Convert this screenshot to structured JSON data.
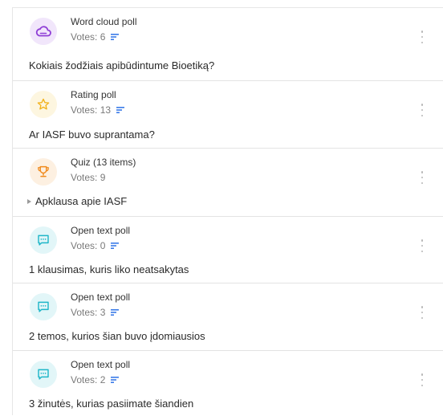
{
  "polls": [
    {
      "kind": "word-cloud",
      "type_label": "Word cloud poll",
      "votes_label": "Votes: 6",
      "results_icon": true,
      "question": "Kokiais žodžiais apibūdintume Bioetiką?",
      "icon": "word-cloud-icon",
      "icon_color": "#8f3fd6",
      "icon_bg": "#f1e6fb"
    },
    {
      "kind": "rating",
      "type_label": "Rating poll",
      "votes_label": "Votes: 13",
      "results_icon": true,
      "question": "Ar IASF buvo suprantama?",
      "icon": "star-icon",
      "icon_color": "#f2b21b",
      "icon_bg": "#fdf6e0"
    },
    {
      "kind": "quiz",
      "type_label": "Quiz (13 items)",
      "votes_label": "Votes: 9",
      "results_icon": false,
      "question": "Apklausa apie IASF",
      "icon": "trophy-icon",
      "icon_color": "#f08a1c",
      "icon_bg": "#fdf0e1"
    },
    {
      "kind": "open-text",
      "type_label": "Open text poll",
      "votes_label": "Votes: 0",
      "results_icon": true,
      "question": "1 klausimas, kuris liko neatsakytas",
      "icon": "chat-icon",
      "icon_color": "#1fb6c8",
      "icon_bg": "#e2f6f8"
    },
    {
      "kind": "open-text",
      "type_label": "Open text poll",
      "votes_label": "Votes: 3",
      "results_icon": true,
      "question": "2 temos, kurios šian buvo įdomiausios",
      "icon": "chat-icon",
      "icon_color": "#1fb6c8",
      "icon_bg": "#e2f6f8"
    },
    {
      "kind": "open-text",
      "type_label": "Open text poll",
      "votes_label": "Votes: 2",
      "results_icon": true,
      "question": "3 žinutės, kurias pasiimate šiandien",
      "icon": "chat-icon",
      "icon_color": "#1fb6c8",
      "icon_bg": "#e2f6f8"
    }
  ],
  "colors": {
    "results_bars": "#3b7be8",
    "menu_dots": "#b7b7b7"
  }
}
